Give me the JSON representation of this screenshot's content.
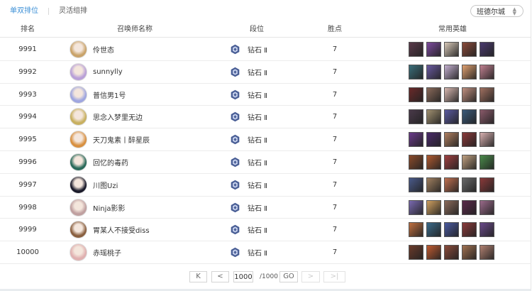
{
  "tabs": [
    "单双排位",
    "灵活组排"
  ],
  "server": {
    "label": "班德尔城"
  },
  "columns": [
    "排名",
    "召唤师名称",
    "段位",
    "胜点",
    "常用英雄"
  ],
  "rows": [
    {
      "rank": "9991",
      "name": "伶世态",
      "tier": "钻石 Ⅱ",
      "wins": "7",
      "avatar_color": "#c9a36a",
      "heroes": [
        "#5a3a4a",
        "#7d4a9e",
        "#d8c9b8",
        "#8a4b3a",
        "#4a3a6e"
      ]
    },
    {
      "rank": "9992",
      "name": "sunnylly",
      "tier": "钻石 Ⅱ",
      "wins": "7",
      "avatar_color": "#b9a0d8",
      "heroes": [
        "#3a6e7a",
        "#6a5aa0",
        "#c4b0d0",
        "#e0a070",
        "#c08090"
      ]
    },
    {
      "rank": "9993",
      "name": "普信男1号",
      "tier": "钻石 Ⅱ",
      "wins": "7",
      "avatar_color": "#9fa6e0",
      "heroes": [
        "#6a2a2a",
        "#8a6a5a",
        "#d8b8b0",
        "#c09080",
        "#a07060"
      ]
    },
    {
      "rank": "9994",
      "name": "思念入梦里无边",
      "tier": "钻石 Ⅱ",
      "wins": "7",
      "avatar_color": "#c8b060",
      "heroes": [
        "#4a3a4a",
        "#a09070",
        "#5a5aa0",
        "#3a5a7a",
        "#8a5a6a"
      ]
    },
    {
      "rank": "9995",
      "name": "天刀鬼素丨醉星辰",
      "tier": "钻石 Ⅱ",
      "wins": "7",
      "avatar_color": "#d89040",
      "heroes": [
        "#6a3a8a",
        "#4a2a6a",
        "#b08060",
        "#8a3a3a",
        "#d8b0b0"
      ]
    },
    {
      "rank": "9996",
      "name": "回忆的毒药",
      "tier": "钻石 Ⅱ",
      "wins": "7",
      "avatar_color": "#2a6a5a",
      "heroes": [
        "#8a4a2a",
        "#b05a30",
        "#a04040",
        "#c0a080",
        "#4a8a4a"
      ]
    },
    {
      "rank": "9997",
      "name": "川图Uzi",
      "tier": "钻石 Ⅱ",
      "wins": "7",
      "avatar_color": "#1a1a2a",
      "heroes": [
        "#4a5a8a",
        "#a08060",
        "#c07050",
        "#6a6a6a",
        "#8a3a3a"
      ]
    },
    {
      "rank": "9998",
      "name": "Ninja影影",
      "tier": "钻石 Ⅱ",
      "wins": "7",
      "avatar_color": "#c0a0a0",
      "heroes": [
        "#7a6ab0",
        "#d0a060",
        "#8a6a5a",
        "#5a2a4a",
        "#9a6a8a"
      ]
    },
    {
      "rank": "9999",
      "name": "胃某人不接受diss",
      "tier": "钻石 Ⅱ",
      "wins": "7",
      "avatar_color": "#8a6040",
      "heroes": [
        "#c07040",
        "#3a6a8a",
        "#4a5aa0",
        "#8a3a3a",
        "#6a4a8a"
      ]
    },
    {
      "rank": "10000",
      "name": "赤瑶桃子",
      "tier": "钻石 Ⅱ",
      "wins": "7",
      "avatar_color": "#e0b0b0",
      "heroes": [
        "#6a3a2a",
        "#c05a30",
        "#8a4a3a",
        "#a07050",
        "#b08070"
      ]
    }
  ],
  "pagination": {
    "first": "K",
    "prev": "<",
    "page": "1000",
    "total": "/1000",
    "go": "GO",
    "next": ">",
    "last": ">|"
  },
  "colors": {
    "accent": "#3b8fd6",
    "tier_icon": "#4a5f96"
  }
}
